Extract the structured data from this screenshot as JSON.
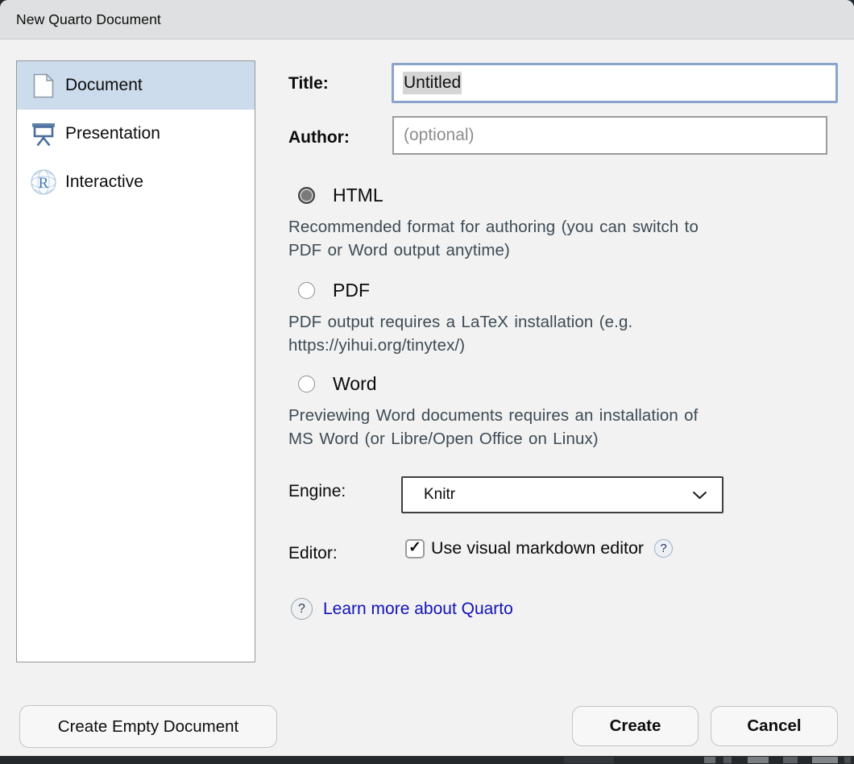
{
  "window": {
    "title": "New Quarto Document"
  },
  "sidebar": {
    "items": [
      {
        "label": "Document",
        "icon": "document-icon",
        "selected": true
      },
      {
        "label": "Presentation",
        "icon": "presentation-icon",
        "selected": false
      },
      {
        "label": "Interactive",
        "icon": "r-logo-icon",
        "selected": false
      }
    ]
  },
  "form": {
    "title": {
      "label": "Title:",
      "value": "Untitled"
    },
    "author": {
      "label": "Author:",
      "placeholder": "(optional)"
    },
    "formats": [
      {
        "label": "HTML",
        "selected": true,
        "description_lines": [
          "Recommended format for authoring (you can switch to",
          "PDF or Word output anytime)"
        ]
      },
      {
        "label": "PDF",
        "selected": false,
        "description_lines": [
          "PDF output requires a LaTeX installation (e.g.",
          "https://yihui.org/tinytex/)"
        ]
      },
      {
        "label": "Word",
        "selected": false,
        "description_lines": [
          "Previewing Word documents requires an installation of",
          "MS Word (or Libre/Open Office on Linux)"
        ]
      }
    ],
    "engine": {
      "label": "Engine:",
      "value": "Knitr"
    },
    "editor": {
      "label": "Editor:",
      "checkbox_label": "Use visual markdown editor",
      "checked": true
    }
  },
  "learn_more": {
    "label": "Learn more about Quarto"
  },
  "footer": {
    "create_empty_label": "Create Empty Document",
    "create_label": "Create",
    "cancel_label": "Cancel"
  },
  "icons": {
    "check_glyph": "✓",
    "help_glyph": "?"
  },
  "colors": {
    "sidebar_selected_bg": "#ccdcec",
    "icon_blue": "#4a6e99",
    "r_logo_blue": "#4178b4",
    "link_blue": "#1412b8",
    "focus_border_blue": "#8ba4ce",
    "description_text": "#3e4a54",
    "selection_highlight": "#d5d5d5"
  }
}
